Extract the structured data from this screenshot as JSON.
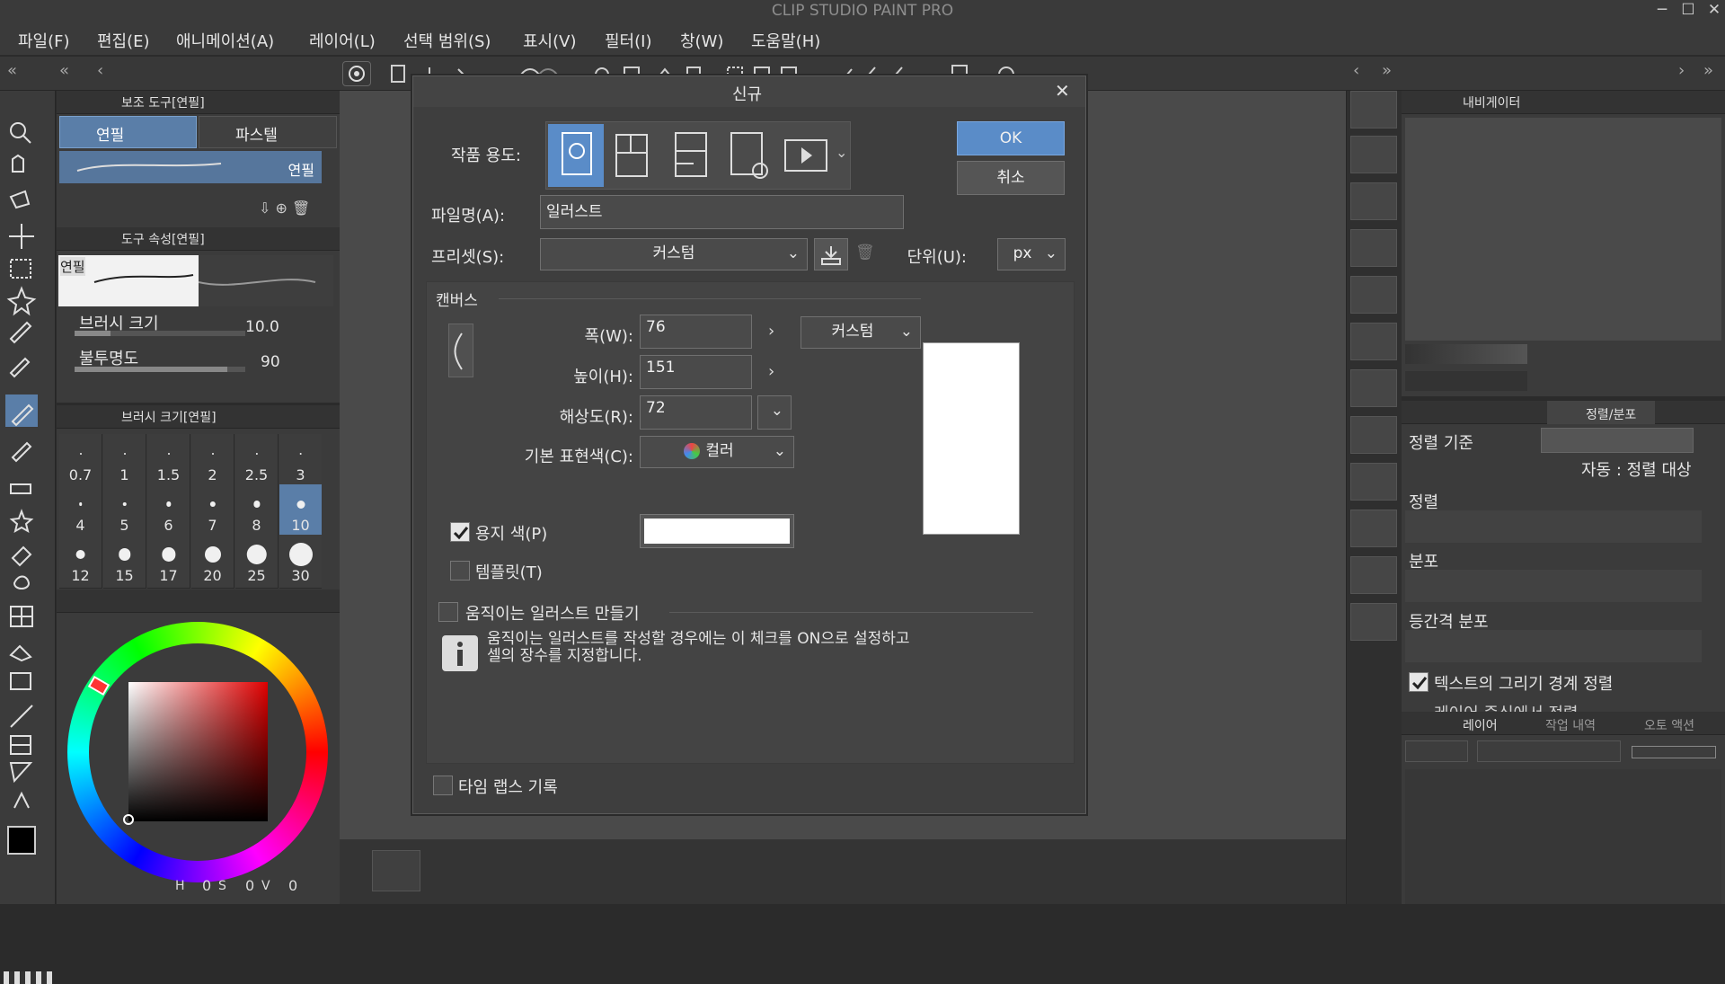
{
  "app": {
    "title": "CLIP STUDIO PAINT PRO",
    "minimize": "─",
    "maximize": "☐",
    "close": "✕"
  },
  "menu": [
    "파일(F)",
    "편집(E)",
    "애니메이션(A)",
    "레이어(L)",
    "선택 범위(S)",
    "표시(V)",
    "필터(I)",
    "창(W)",
    "도움말(H)"
  ],
  "subtool_panel": {
    "title": "보조 도구[연필]",
    "tabs": [
      "연필",
      "파스텔"
    ],
    "brush_preview_label": "연필"
  },
  "tool_property": {
    "title": "도구 속성[연필]",
    "preview_label": "연필",
    "brush_size_label": "브러시 크기",
    "brush_size_value": "10.0",
    "opacity_label": "불투명도",
    "opacity_value": "90"
  },
  "brush_size_panel": {
    "title": "브러시 크기[연필]",
    "sizes": [
      "0.7",
      "1",
      "1.5",
      "2",
      "2.5",
      "3",
      "4",
      "5",
      "6",
      "7",
      "8",
      "10",
      "12",
      "15",
      "17",
      "20",
      "25",
      "30"
    ],
    "selected": "10"
  },
  "color": {
    "hue_label": "H",
    "h": "0",
    "sat_label": "S",
    "s": "0",
    "val_label": "V",
    "v": "0",
    "main": "#000000",
    "sub": "#ffffff"
  },
  "dialog": {
    "title": "신규",
    "close": "✕",
    "usage_label": "작품 용도:",
    "usage_icons": [
      "illustration-icon",
      "comic-icon",
      "comic-print-icon",
      "comic-settings-icon",
      "animation-icon"
    ],
    "ok": "OK",
    "cancel": "취소",
    "filename_label": "파일명(A):",
    "filename_value": "일러스트",
    "preset_label": "프리셋(S):",
    "preset_value": "커스텀",
    "unit_label": "단위(U):",
    "unit_value": "px",
    "canvas_section": "캔버스",
    "width_label": "폭(W):",
    "width_value": "76",
    "height_label": "높이(H):",
    "height_value": "151",
    "resolution_label": "해상도(R):",
    "resolution_value": "72",
    "size_preset_value": "커스텀",
    "color_mode_label": "기본 표현색(C):",
    "color_mode_value": "컬러",
    "paper_color_label": "용지 색(P)",
    "paper_color_checked": true,
    "paper_color": "#ffffff",
    "template_label": "템플릿(T)",
    "template_checked": false,
    "animated_label": "움직이는 일러스트 만들기",
    "animated_checked": false,
    "info_text": "움직이는 일러스트를 작성할 경우에는 이 체크를 ON으로 설정하고\n셀의 장수를 지정합니다.",
    "timelapse_label": "타임 랩스 기록",
    "timelapse_checked": false
  },
  "navigator": {
    "title": "내비게이터"
  },
  "align_panel": {
    "title": "정렬/분포",
    "basis_label": "정렬 기준",
    "auto_label": "자동 : 정렬 대상",
    "align_label": "정렬",
    "distribute_label": "분포",
    "equal_label": "등간격 분포",
    "text_bounds_label": "텍스트의 그리기 경계 정렬",
    "text_bounds_checked": true,
    "extra_label": "레이어 중심에서 정렬"
  },
  "layer_panel": {
    "tabs": [
      "레이어",
      "작업 내역",
      "오토 액션"
    ]
  }
}
